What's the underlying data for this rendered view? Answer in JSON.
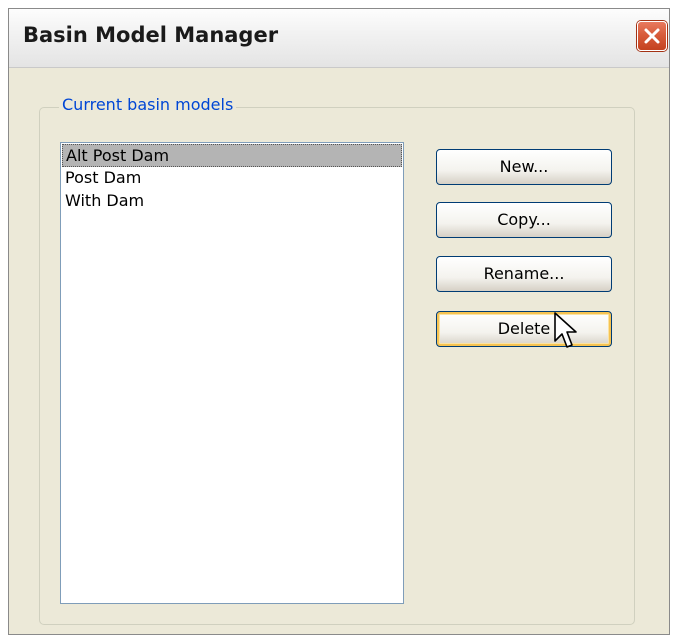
{
  "window": {
    "title": "Basin Model Manager",
    "close_icon": "close-icon"
  },
  "group": {
    "label": "Current basin models"
  },
  "list": {
    "items": [
      "Alt Post Dam",
      "Post Dam",
      "With Dam"
    ],
    "selected_index": 0
  },
  "buttons": {
    "new": "New...",
    "copy": "Copy...",
    "rename": "Rename...",
    "delete": "Delete"
  },
  "colors": {
    "group_label": "#0046d5",
    "close_button": "#d85c3b",
    "selection": "#b4b4b4",
    "hover_outline": "#f6c352"
  },
  "cursor": {
    "icon": "arrow-pointer-icon"
  }
}
